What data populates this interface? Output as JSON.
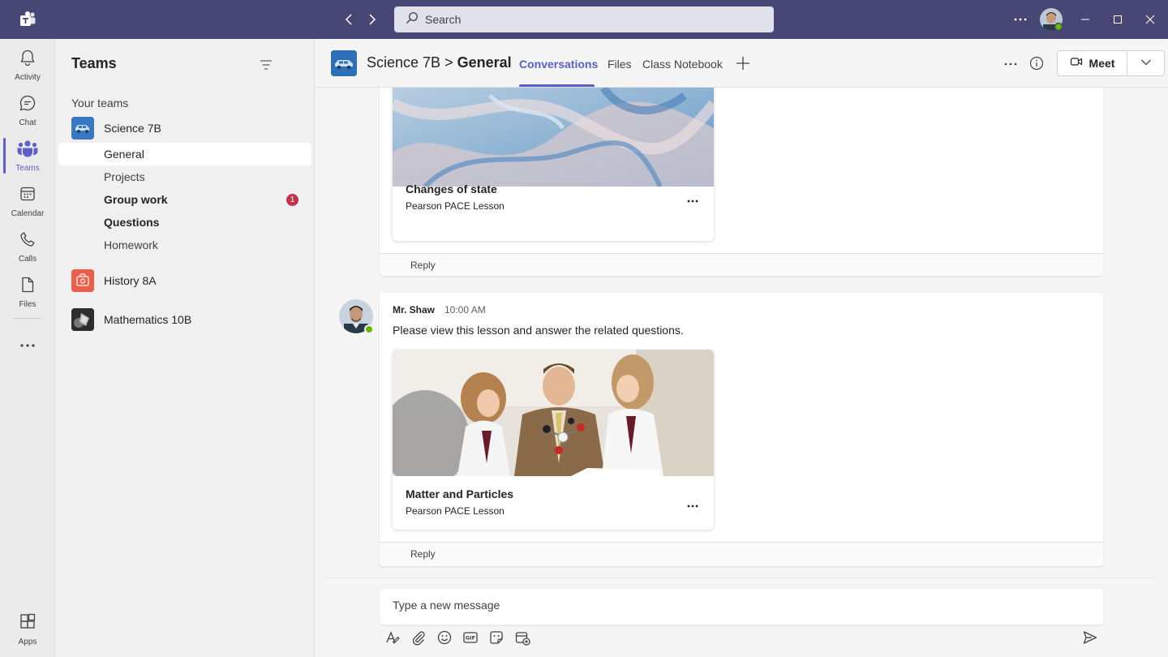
{
  "titlebar": {
    "search_placeholder": "Search",
    "colors": {
      "bg": "#464775",
      "accent": "#5b5fc7"
    }
  },
  "rail": {
    "items": [
      {
        "label": "Activity",
        "icon": "bell-icon"
      },
      {
        "label": "Chat",
        "icon": "chat-icon"
      },
      {
        "label": "Teams",
        "icon": "teams-icon",
        "active": true
      },
      {
        "label": "Calendar",
        "icon": "calendar-icon"
      },
      {
        "label": "Calls",
        "icon": "phone-icon"
      },
      {
        "label": "Files",
        "icon": "file-icon"
      }
    ],
    "apps_label": "Apps"
  },
  "panel": {
    "title": "Teams",
    "section_label": "Your teams",
    "teams": [
      {
        "name": "Science 7B",
        "channels": [
          {
            "name": "General",
            "active": true
          },
          {
            "name": "Projects"
          },
          {
            "name": "Group work",
            "bold": true,
            "badge": "1"
          },
          {
            "name": "Questions",
            "bold": true
          },
          {
            "name": "Homework"
          }
        ]
      },
      {
        "name": "History 8A"
      },
      {
        "name": "Mathematics 10B"
      }
    ]
  },
  "header": {
    "team": "Science 7B",
    "separator": ">",
    "channel": "General",
    "tabs": [
      {
        "label": "Conversations",
        "active": true
      },
      {
        "label": "Files"
      },
      {
        "label": "Class Notebook"
      }
    ],
    "meet_label": "Meet"
  },
  "conversation": {
    "posts": [
      {
        "card": {
          "title": "Changes of state",
          "subtitle": "Pearson PACE Lesson"
        },
        "reply_label": "Reply"
      },
      {
        "author": "Mr. Shaw",
        "time": "10:00 AM",
        "text": "Please view this lesson and answer the related questions.",
        "card": {
          "title": "Matter and Particles",
          "subtitle": "Pearson PACE Lesson"
        },
        "reply_label": "Reply"
      }
    ]
  },
  "compose": {
    "placeholder": "Type a new message"
  }
}
